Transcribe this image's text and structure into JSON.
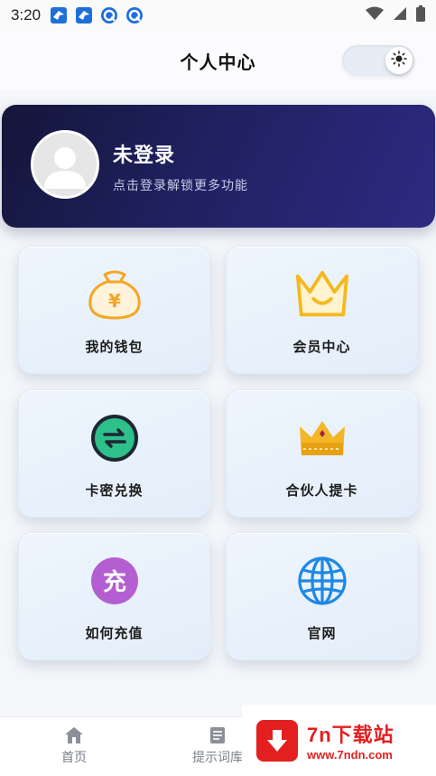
{
  "status_bar": {
    "time": "3:20",
    "left_icons": [
      "bird-notification-icon",
      "bird-notification-icon",
      "q-notification-icon",
      "q-notification-icon"
    ],
    "right_icons": [
      "wifi-icon",
      "signal-icon",
      "battery-icon"
    ]
  },
  "header": {
    "title": "个人中心",
    "theme_toggle_icon": "sun-icon"
  },
  "profile": {
    "title": "未登录",
    "subtitle": "点击登录解锁更多功能",
    "avatar_icon": "default-avatar-icon"
  },
  "menu": [
    {
      "label": "我的钱包",
      "icon": "money-bag-icon",
      "color": "#f5a623"
    },
    {
      "label": "会员中心",
      "icon": "crown-icon",
      "color": "#f5b91f"
    },
    {
      "label": "卡密兑换",
      "icon": "exchange-icon",
      "color": "#2ec08a"
    },
    {
      "label": "合伙人提卡",
      "icon": "gold-crown-icon",
      "color": "#f3b626"
    },
    {
      "label": "如何充值",
      "icon": "recharge-icon",
      "color": "#b35fd1"
    },
    {
      "label": "官网",
      "icon": "globe-icon",
      "color": "#1e88e5"
    }
  ],
  "bottom_nav": [
    {
      "label": "首页",
      "icon": "home-icon"
    },
    {
      "label": "提示词库",
      "icon": "document-icon"
    }
  ],
  "watermark": {
    "title": "7n下载站",
    "url": "www.7ndn.com"
  },
  "colors": {
    "card_gradient_start": "#14163a",
    "card_gradient_end": "#2e2a82",
    "watermark_red": "#e41f1f"
  }
}
